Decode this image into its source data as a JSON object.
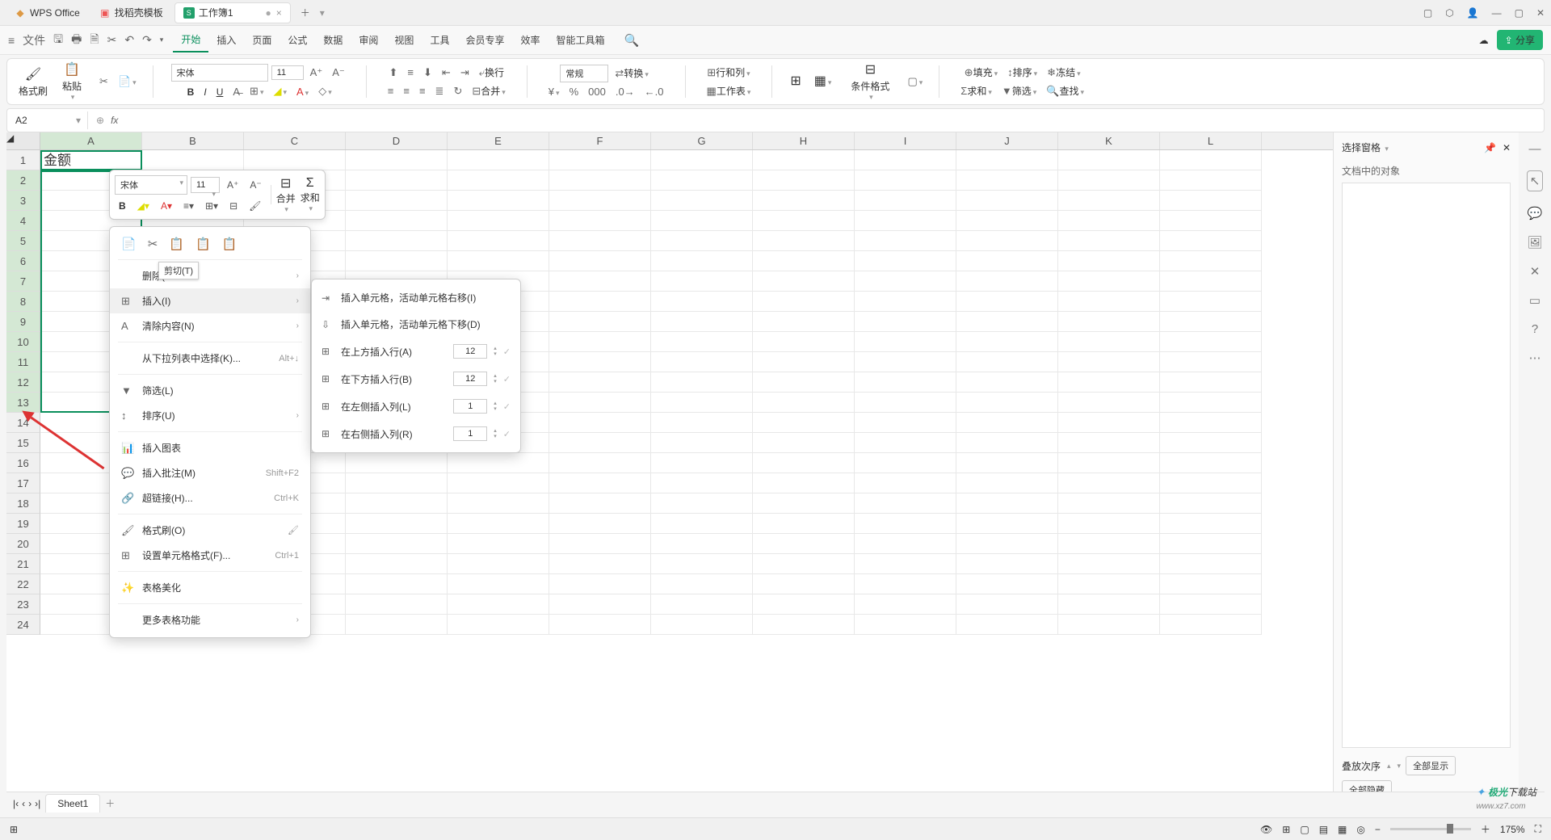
{
  "titlebar": {
    "app": "WPS Office",
    "tab2": "找稻壳模板",
    "tab3": "工作簿1",
    "modified": "●"
  },
  "menubar": {
    "file": "文件",
    "items": [
      "开始",
      "插入",
      "页面",
      "公式",
      "数据",
      "审阅",
      "视图",
      "工具",
      "会员专享",
      "效率",
      "智能工具箱"
    ]
  },
  "share": "分享",
  "ribbon": {
    "formatbrush": "格式刷",
    "paste": "粘贴",
    "font": "宋体",
    "size": "11",
    "wrap": "换行",
    "general": "常规",
    "convert": "转换",
    "rowcol": "行和列",
    "worksheet": "工作表",
    "condformat": "条件格式",
    "fill": "填充",
    "sort": "排序",
    "freeze": "冻结",
    "sum": "求和",
    "filter": "筛选",
    "find": "查找",
    "merge": "合并"
  },
  "namebox": "A2",
  "fx": "fx",
  "columns": [
    "A",
    "B",
    "C",
    "D",
    "E",
    "F",
    "G",
    "H",
    "I",
    "J",
    "K",
    "L"
  ],
  "cell_a1": "金额",
  "mini": {
    "font": "宋体",
    "size": "11",
    "merge": "合并",
    "sum": "求和"
  },
  "ctx": {
    "delete": "删除(",
    "cut_tip": "剪切(T)",
    "insert": "插入(I)",
    "clear": "清除内容(N)",
    "dropdown": "从下拉列表中选择(K)...",
    "dropdown_sc": "Alt+↓",
    "filter": "筛选(L)",
    "sort": "排序(U)",
    "insert_chart": "插入图表",
    "insert_comment": "插入批注(M)",
    "comment_sc": "Shift+F2",
    "hyperlink": "超链接(H)...",
    "hyperlink_sc": "Ctrl+K",
    "formatbrush": "格式刷(O)",
    "cellformat": "设置单元格格式(F)...",
    "cellformat_sc": "Ctrl+1",
    "beautify": "表格美化",
    "more": "更多表格功能"
  },
  "sub": {
    "shift_right": "插入单元格，活动单元格右移(I)",
    "shift_down": "插入单元格，活动单元格下移(D)",
    "row_above": "在上方插入行(A)",
    "row_below": "在下方插入行(B)",
    "col_left": "在左侧插入列(L)",
    "col_right": "在右侧插入列(R)",
    "v12": "12",
    "v1": "1"
  },
  "side": {
    "title": "选择窗格",
    "objects": "文档中的对象",
    "stack": "叠放次序",
    "showall": "全部显示",
    "hideall": "全部隐藏"
  },
  "sheet": "Sheet1",
  "status": {
    "zoom": "175%"
  },
  "watermark": {
    "a": "极光",
    "b": "下载站",
    "url": "www.xz7.com"
  }
}
